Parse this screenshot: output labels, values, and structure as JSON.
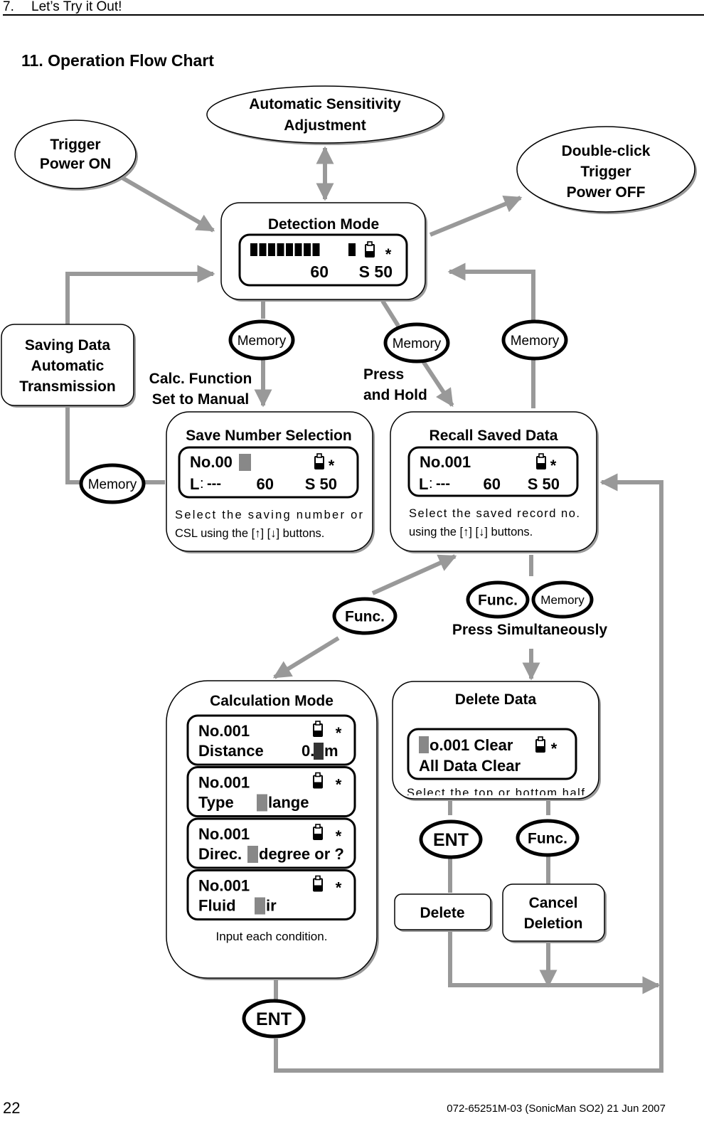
{
  "header": {
    "chapter_number": "7.",
    "chapter_title": "Let’s Try it Out!"
  },
  "section_title": "11.  Operation Flow Chart",
  "footer": {
    "page_number": "22",
    "doc_ref": "072-65251M-03 (SonicMan SO2)    21 Jun 2007"
  },
  "colors": {
    "arrow": "#999999",
    "stroke": "#000000",
    "cursor": "#888888",
    "shadow": "#9a9a9a"
  },
  "nodes": {
    "trigger_on": [
      "Trigger",
      "Power ON"
    ],
    "auto_sens": [
      "Automatic Sensitivity",
      "Adjustment"
    ],
    "double_click_off": [
      "Double-click",
      "Trigger",
      "Power OFF"
    ],
    "detection": {
      "title": "Detection Mode",
      "row2_a": "60",
      "row2_b": "S 50",
      "bar_segments": 8
    },
    "saving_data": [
      "Saving Data",
      "Automatic",
      "Transmission"
    ],
    "save_number": {
      "title": "Save Number Selection",
      "row1": "No.00",
      "row2_label": "L",
      "row2_colon": ":",
      "row2_dash": "---",
      "row2_a": "60",
      "row2_b": "S 50",
      "desc_line1": "Select  the  saving  number  or",
      "desc_line2": "CSL using the [↑] [↓] buttons."
    },
    "recall": {
      "title": "Recall Saved Data",
      "row1": "No.001",
      "row2_label": "L",
      "row2_colon": ":",
      "row2_dash": "---",
      "row2_a": "60",
      "row2_b": "S 50",
      "desc_line1": "Select  the  saved  record  no.",
      "desc_line2": "using the [↑] [↓] buttons."
    },
    "calculation": {
      "title": "Calculation Mode",
      "screens": [
        {
          "row1": "No.001",
          "row2_label": "Distance",
          "row2_value_pre": "0.",
          "row2_value_post": "m"
        },
        {
          "row1": "No.001",
          "row2_label": "Type",
          "row2_value_pre": "",
          "row2_value_post": "lange"
        },
        {
          "row1": "No.001",
          "row2_label": "Direc.",
          "row2_value_pre": "",
          "row2_value_post": "degree or ?"
        },
        {
          "row1": "No.001",
          "row2_label": "Fluid",
          "row2_value_pre": "",
          "row2_value_post": "ir"
        }
      ],
      "desc": "Input each condition."
    },
    "delete_data": {
      "title": "Delete Data",
      "row1": "o.001 Clear",
      "row2": "All Data Clear",
      "desc": "Select  the  top  or  bottom  half"
    },
    "delete": "Delete",
    "cancel_deletion": [
      "Cancel",
      "Deletion"
    ]
  },
  "keys": {
    "memory": "Memory",
    "func": "Func.",
    "ent": "ENT"
  },
  "labels": {
    "calc_function": [
      "Calc. Function",
      "Set to Manual"
    ],
    "press_hold": [
      "Press",
      "and Hold"
    ],
    "press_simultaneously": "Press Simultaneously"
  }
}
